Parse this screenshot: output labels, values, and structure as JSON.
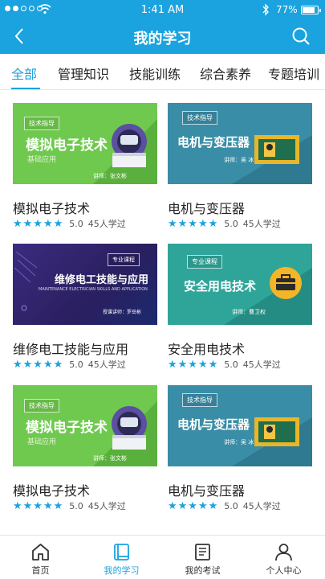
{
  "status_bar": {
    "time": "1:41 AM",
    "battery": "77%"
  },
  "header": {
    "title": "我的学习"
  },
  "tabs": [
    {
      "label": "全部",
      "active": true
    },
    {
      "label": "管理知识",
      "active": false
    },
    {
      "label": "技能训练",
      "active": false
    },
    {
      "label": "综合素养",
      "active": false
    },
    {
      "label": "专题培训",
      "active": false
    }
  ],
  "courses": [
    {
      "title": "模拟电子技术",
      "stars": "★★★★★",
      "score": "5.0",
      "learners": "45人学过",
      "thumb": {
        "tag": "技术指导",
        "big": "模拟电子技术",
        "sub": "基础应用",
        "lecturer": "讲师：张文彬"
      }
    },
    {
      "title": "电机与变压器",
      "stars": "★★★★★",
      "score": "5.0",
      "learners": "45人学过",
      "thumb": {
        "tag": "技术指导",
        "big": "电机与变压器",
        "lecturer": "讲师：吴  冰"
      }
    },
    {
      "title": "维修电工技能与应用",
      "stars": "★★★★★",
      "score": "5.0",
      "learners": "45人学过",
      "thumb": {
        "tag": "专业课程",
        "big": "维修电工技能与应用",
        "sub": "MAINTENANCE ELECTRICIAN SKILLS AND APPLICATION",
        "lecturer": "授课讲师：罗岳彬"
      }
    },
    {
      "title": "安全用电技术",
      "stars": "★★★★★",
      "score": "5.0",
      "learners": "45人学过",
      "thumb": {
        "tag": "专业课程",
        "big": "安全用电技术",
        "lecturer": "讲师：曹卫权"
      }
    },
    {
      "title": "模拟电子技术",
      "stars": "★★★★★",
      "score": "5.0",
      "learners": "45人学过",
      "thumb": {
        "tag": "技术指导",
        "big": "模拟电子技术",
        "sub": "基础应用",
        "lecturer": "讲师：张文彬"
      }
    },
    {
      "title": "电机与变压器",
      "stars": "★★★★★",
      "score": "5.0",
      "learners": "45人学过",
      "thumb": {
        "tag": "技术指导",
        "big": "电机与变压器",
        "lecturer": "讲师：吴  冰"
      }
    }
  ],
  "bottom_nav": [
    {
      "label": "首页",
      "icon": "home-icon",
      "active": false
    },
    {
      "label": "我的学习",
      "icon": "book-icon",
      "active": true
    },
    {
      "label": "我的考试",
      "icon": "exam-icon",
      "active": false
    },
    {
      "label": "个人中心",
      "icon": "person-icon",
      "active": false
    }
  ],
  "colors": {
    "accent": "#1aa3de",
    "star": "#1aa3de"
  }
}
